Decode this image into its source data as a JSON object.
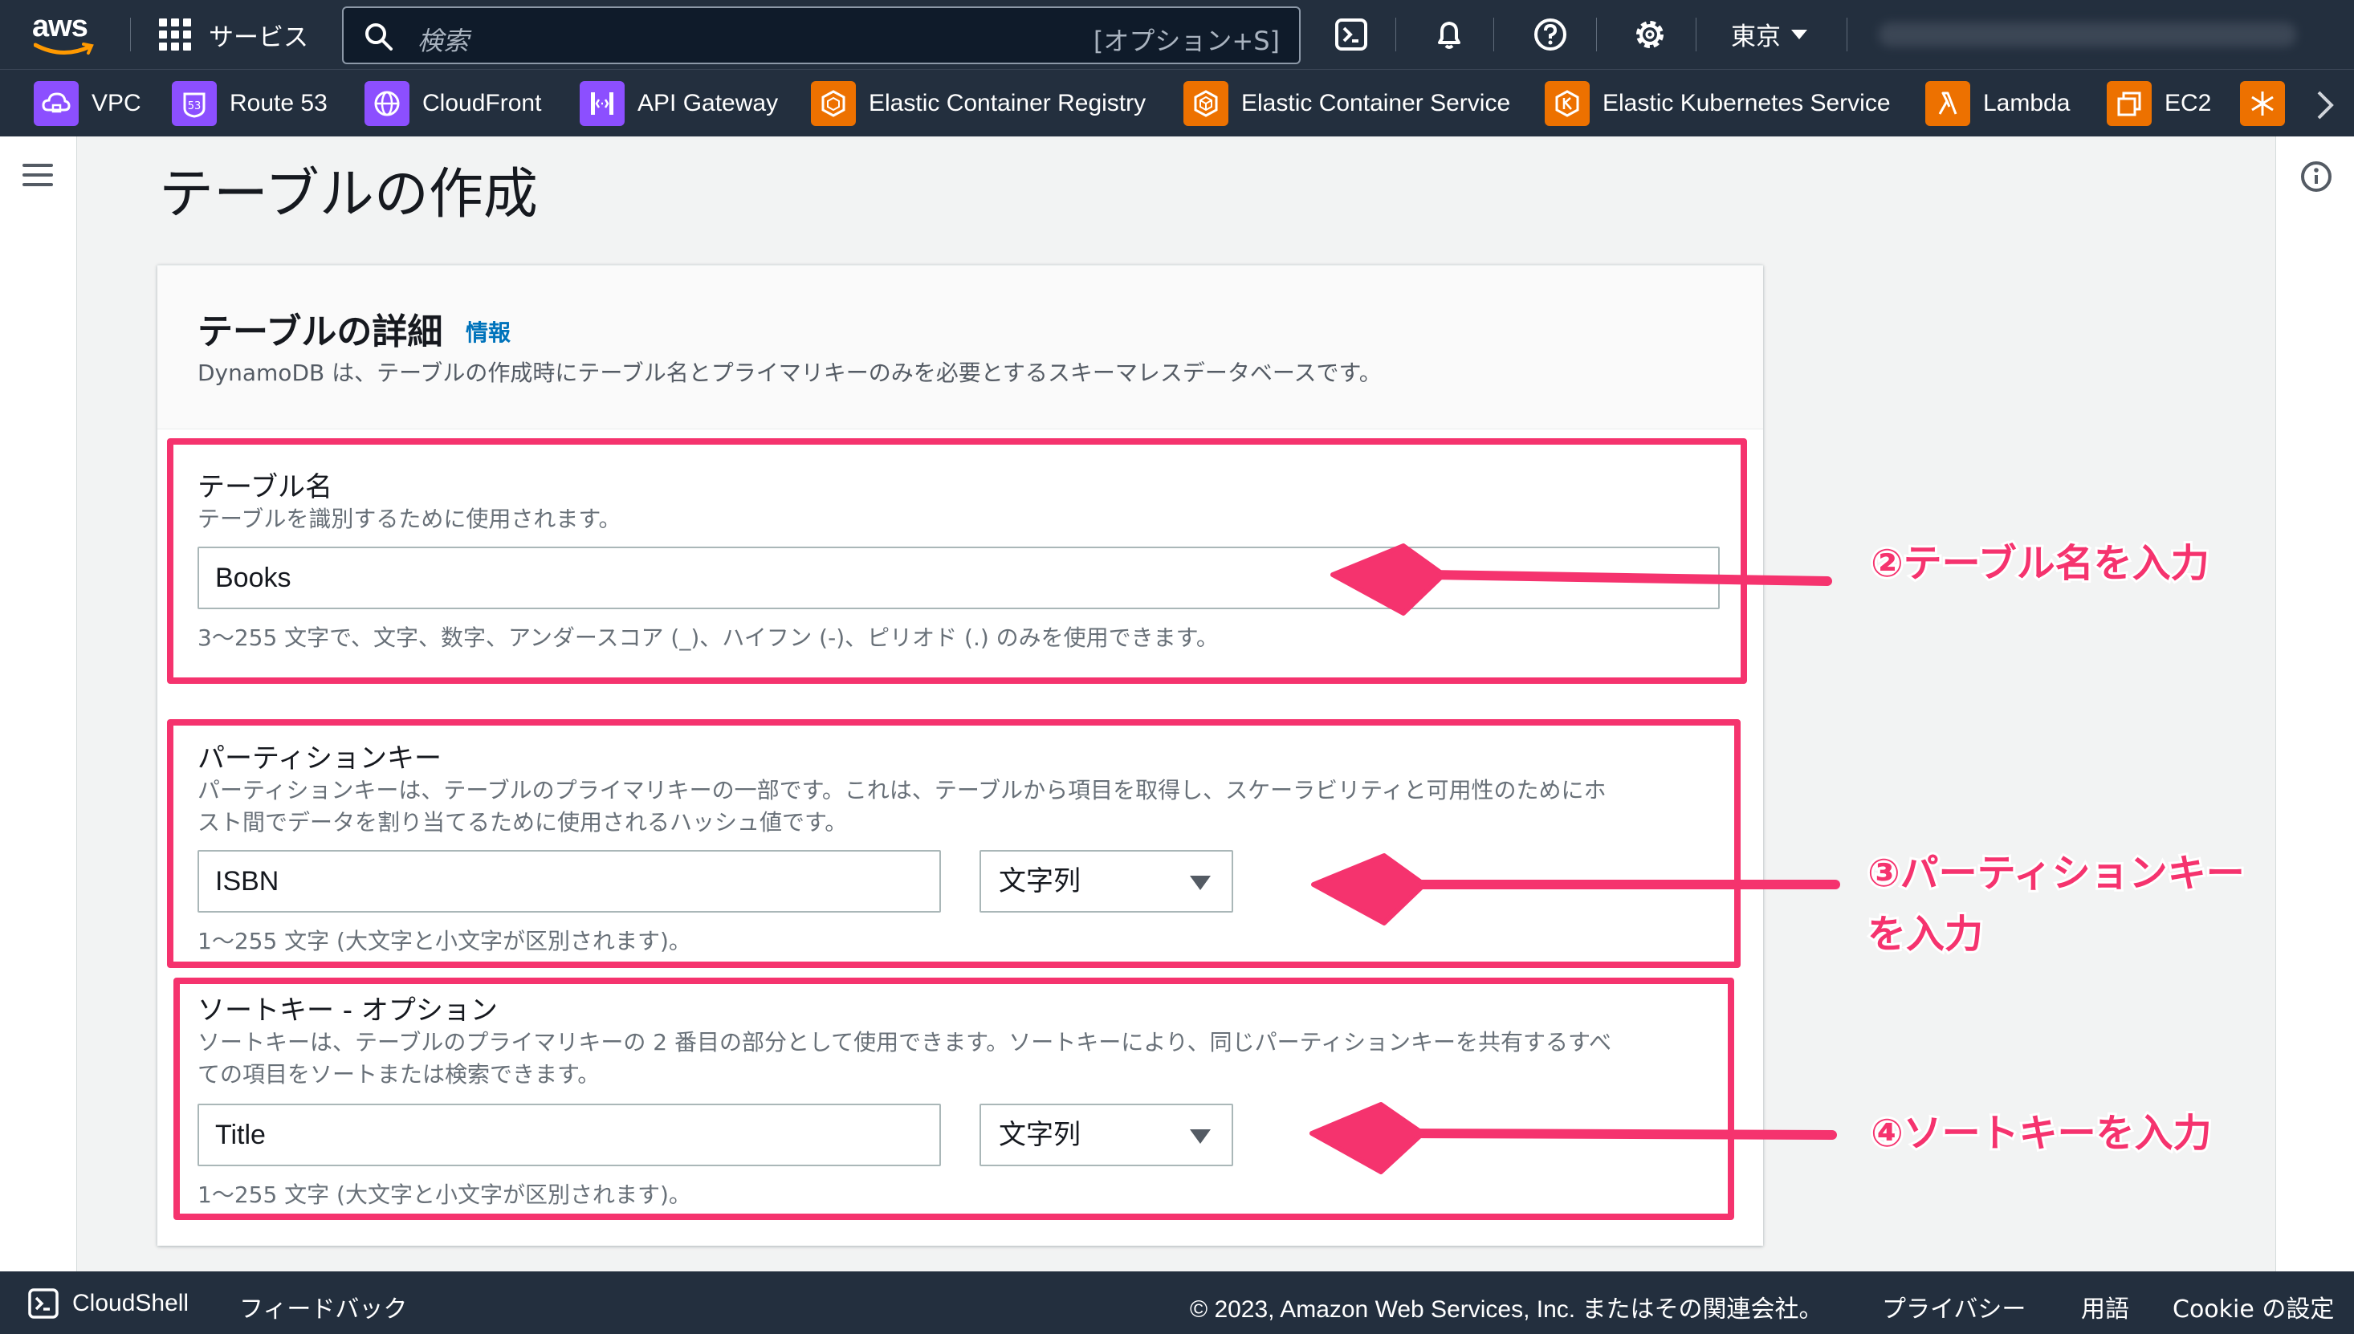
{
  "topnav": {
    "logo_text": "aws",
    "services_label": "サービス",
    "search_placeholder": "検索",
    "search_shortcut": "[オプション+S]",
    "region": "東京"
  },
  "favorites": [
    {
      "label": "VPC",
      "icon": "vpc-icon",
      "color": "#8c4fff"
    },
    {
      "label": "Route 53",
      "icon": "route53-icon",
      "color": "#8c4fff"
    },
    {
      "label": "CloudFront",
      "icon": "cloudfront-icon",
      "color": "#8c4fff"
    },
    {
      "label": "API Gateway",
      "icon": "api-gateway-icon",
      "color": "#8c4fff"
    },
    {
      "label": "Elastic Container Registry",
      "icon": "ecr-icon",
      "color": "#ed7100"
    },
    {
      "label": "Elastic Container Service",
      "icon": "ecs-icon",
      "color": "#ed7100"
    },
    {
      "label": "Elastic Kubernetes Service",
      "icon": "eks-icon",
      "color": "#ed7100"
    },
    {
      "label": "Lambda",
      "icon": "lambda-icon",
      "color": "#ed7100"
    },
    {
      "label": "EC2",
      "icon": "ec2-icon",
      "color": "#ed7100"
    }
  ],
  "page": {
    "title": "テーブルの作成"
  },
  "panel": {
    "title": "テーブルの詳細",
    "info_link": "情報",
    "description": "DynamoDB は、テーブルの作成時にテーブル名とプライマリキーのみを必要とするスキーマレスデータベースです。"
  },
  "table_name": {
    "label": "テーブル名",
    "description": "テーブルを識別するために使用されます。",
    "value": "Books",
    "constraint": "3〜255 文字で、文字、数字、アンダースコア (_)、ハイフン (-)、ピリオド (.) のみを使用できます。"
  },
  "partition_key": {
    "label": "パーティションキー",
    "description_line1": "パーティションキーは、テーブルのプライマリキーの一部です。これは、テーブルから項目を取得し、スケーラビリティと可用性のためにホ",
    "description_line2": "スト間でデータを割り当てるために使用されるハッシュ値です。",
    "value": "ISBN",
    "type": "文字列",
    "constraint": "1〜255 文字 (大文字と小文字が区別されます)。"
  },
  "sort_key": {
    "label": "ソートキー - オプション",
    "description_line1": "ソートキーは、テーブルのプライマリキーの 2 番目の部分として使用できます。ソートキーにより、同じパーティションキーを共有するすべ",
    "description_line2": "ての項目をソートまたは検索できます。",
    "value": "Title",
    "type": "文字列",
    "constraint": "1〜255 文字 (大文字と小文字が区別されます)。"
  },
  "annotations": {
    "step2": "②テーブル名を入力",
    "step3_line1": "③パーティションキー",
    "step3_line2": "を入力",
    "step4": "④ソートキーを入力",
    "color": "#f5336e"
  },
  "footer": {
    "cloudshell": "CloudShell",
    "feedback": "フィードバック",
    "copyright": "© 2023, Amazon Web Services, Inc. またはその関連会社。",
    "privacy": "プライバシー",
    "terms": "用語",
    "cookie": "Cookie の設定"
  }
}
